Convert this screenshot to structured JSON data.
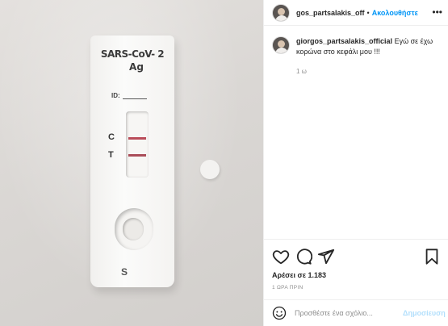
{
  "media": {
    "test_name": "SARS-CoV- 2",
    "test_sub": "Ag",
    "id_label": "ID:",
    "control_label": "C",
    "test_label": "T",
    "sample_label": "S"
  },
  "header": {
    "username": "gos_partsalakis_off",
    "separator": "•",
    "follow_label": "Ακολουθήστε",
    "more_icon": "more-options-icon"
  },
  "caption": {
    "username": "giorgos_partsalakis_official",
    "text": "Εγώ σε έχω κορώνα στο κεφάλι μου !!!",
    "time": "1 ω"
  },
  "actions": {
    "icons": [
      "heart-icon",
      "comment-icon",
      "share-icon",
      "bookmark-icon"
    ]
  },
  "likes": {
    "text": "Αρέσει σε 1.183"
  },
  "timestamp": {
    "text": "1 ΩΡΑ ΠΡΙΝ"
  },
  "add_comment": {
    "placeholder": "Προσθέστε ένα σχόλιο...",
    "post_label": "Δημοσίευση"
  },
  "colors": {
    "accent": "#0095f6",
    "post_disabled": "#b2dffc",
    "text": "#262626",
    "muted": "#8e8e8e"
  }
}
